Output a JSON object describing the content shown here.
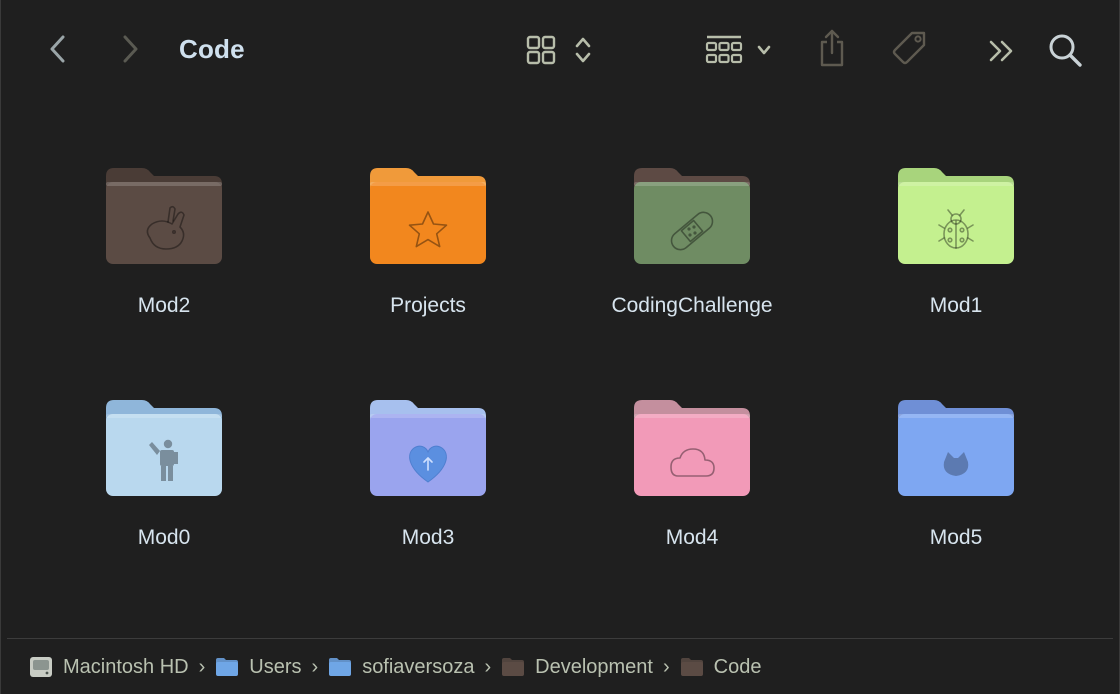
{
  "window": {
    "title": "Code"
  },
  "toolbar": {
    "back_icon": "chevron-left-icon",
    "forward_icon": "chevron-right-icon",
    "view_icon": "icon-grid-view-icon",
    "group_icon": "group-by-icon",
    "share_icon": "share-icon",
    "tag_icon": "tag-icon",
    "more_icon": "double-chevron-icon",
    "search_icon": "magnifier-icon"
  },
  "folders": [
    {
      "name": "Mod2",
      "color": "#5b4b44",
      "tab": "#4a3c36",
      "emblem": "rabbit"
    },
    {
      "name": "Projects",
      "color": "#f2871e",
      "tab": "#f09a3a",
      "emblem": "star"
    },
    {
      "name": "CodingChallenge",
      "color": "#6f8c63",
      "tab": "#5d4a44",
      "emblem": "bandage"
    },
    {
      "name": "Mod1",
      "color": "#c4f08f",
      "tab": "#a8d47c",
      "emblem": "ladybug"
    },
    {
      "name": "Mod0",
      "color": "#b9d8ee",
      "tab": "#8fb6da",
      "emblem": "person"
    },
    {
      "name": "Mod3",
      "color": "#9aa4ee",
      "tab": "#a7c0ee",
      "emblem": "heart"
    },
    {
      "name": "Mod4",
      "color": "#f29ab8",
      "tab": "#c48f9e",
      "emblem": "cloud"
    },
    {
      "name": "Mod5",
      "color": "#7ea7f2",
      "tab": "#6f8fd6",
      "emblem": "cat"
    }
  ],
  "pathbar": [
    {
      "label": "Macintosh HD",
      "icon": "hard-drive-icon",
      "color": "#c8ccc4"
    },
    {
      "label": "Users",
      "icon": "folder-icon",
      "color": "#6fa6e6"
    },
    {
      "label": "sofiaversoza",
      "icon": "folder-icon",
      "color": "#6fa6e6"
    },
    {
      "label": "Development",
      "icon": "folder-icon",
      "color": "#5b4b44"
    },
    {
      "label": "Code",
      "icon": "folder-icon",
      "color": "#5b4b44"
    }
  ],
  "separator": "›"
}
